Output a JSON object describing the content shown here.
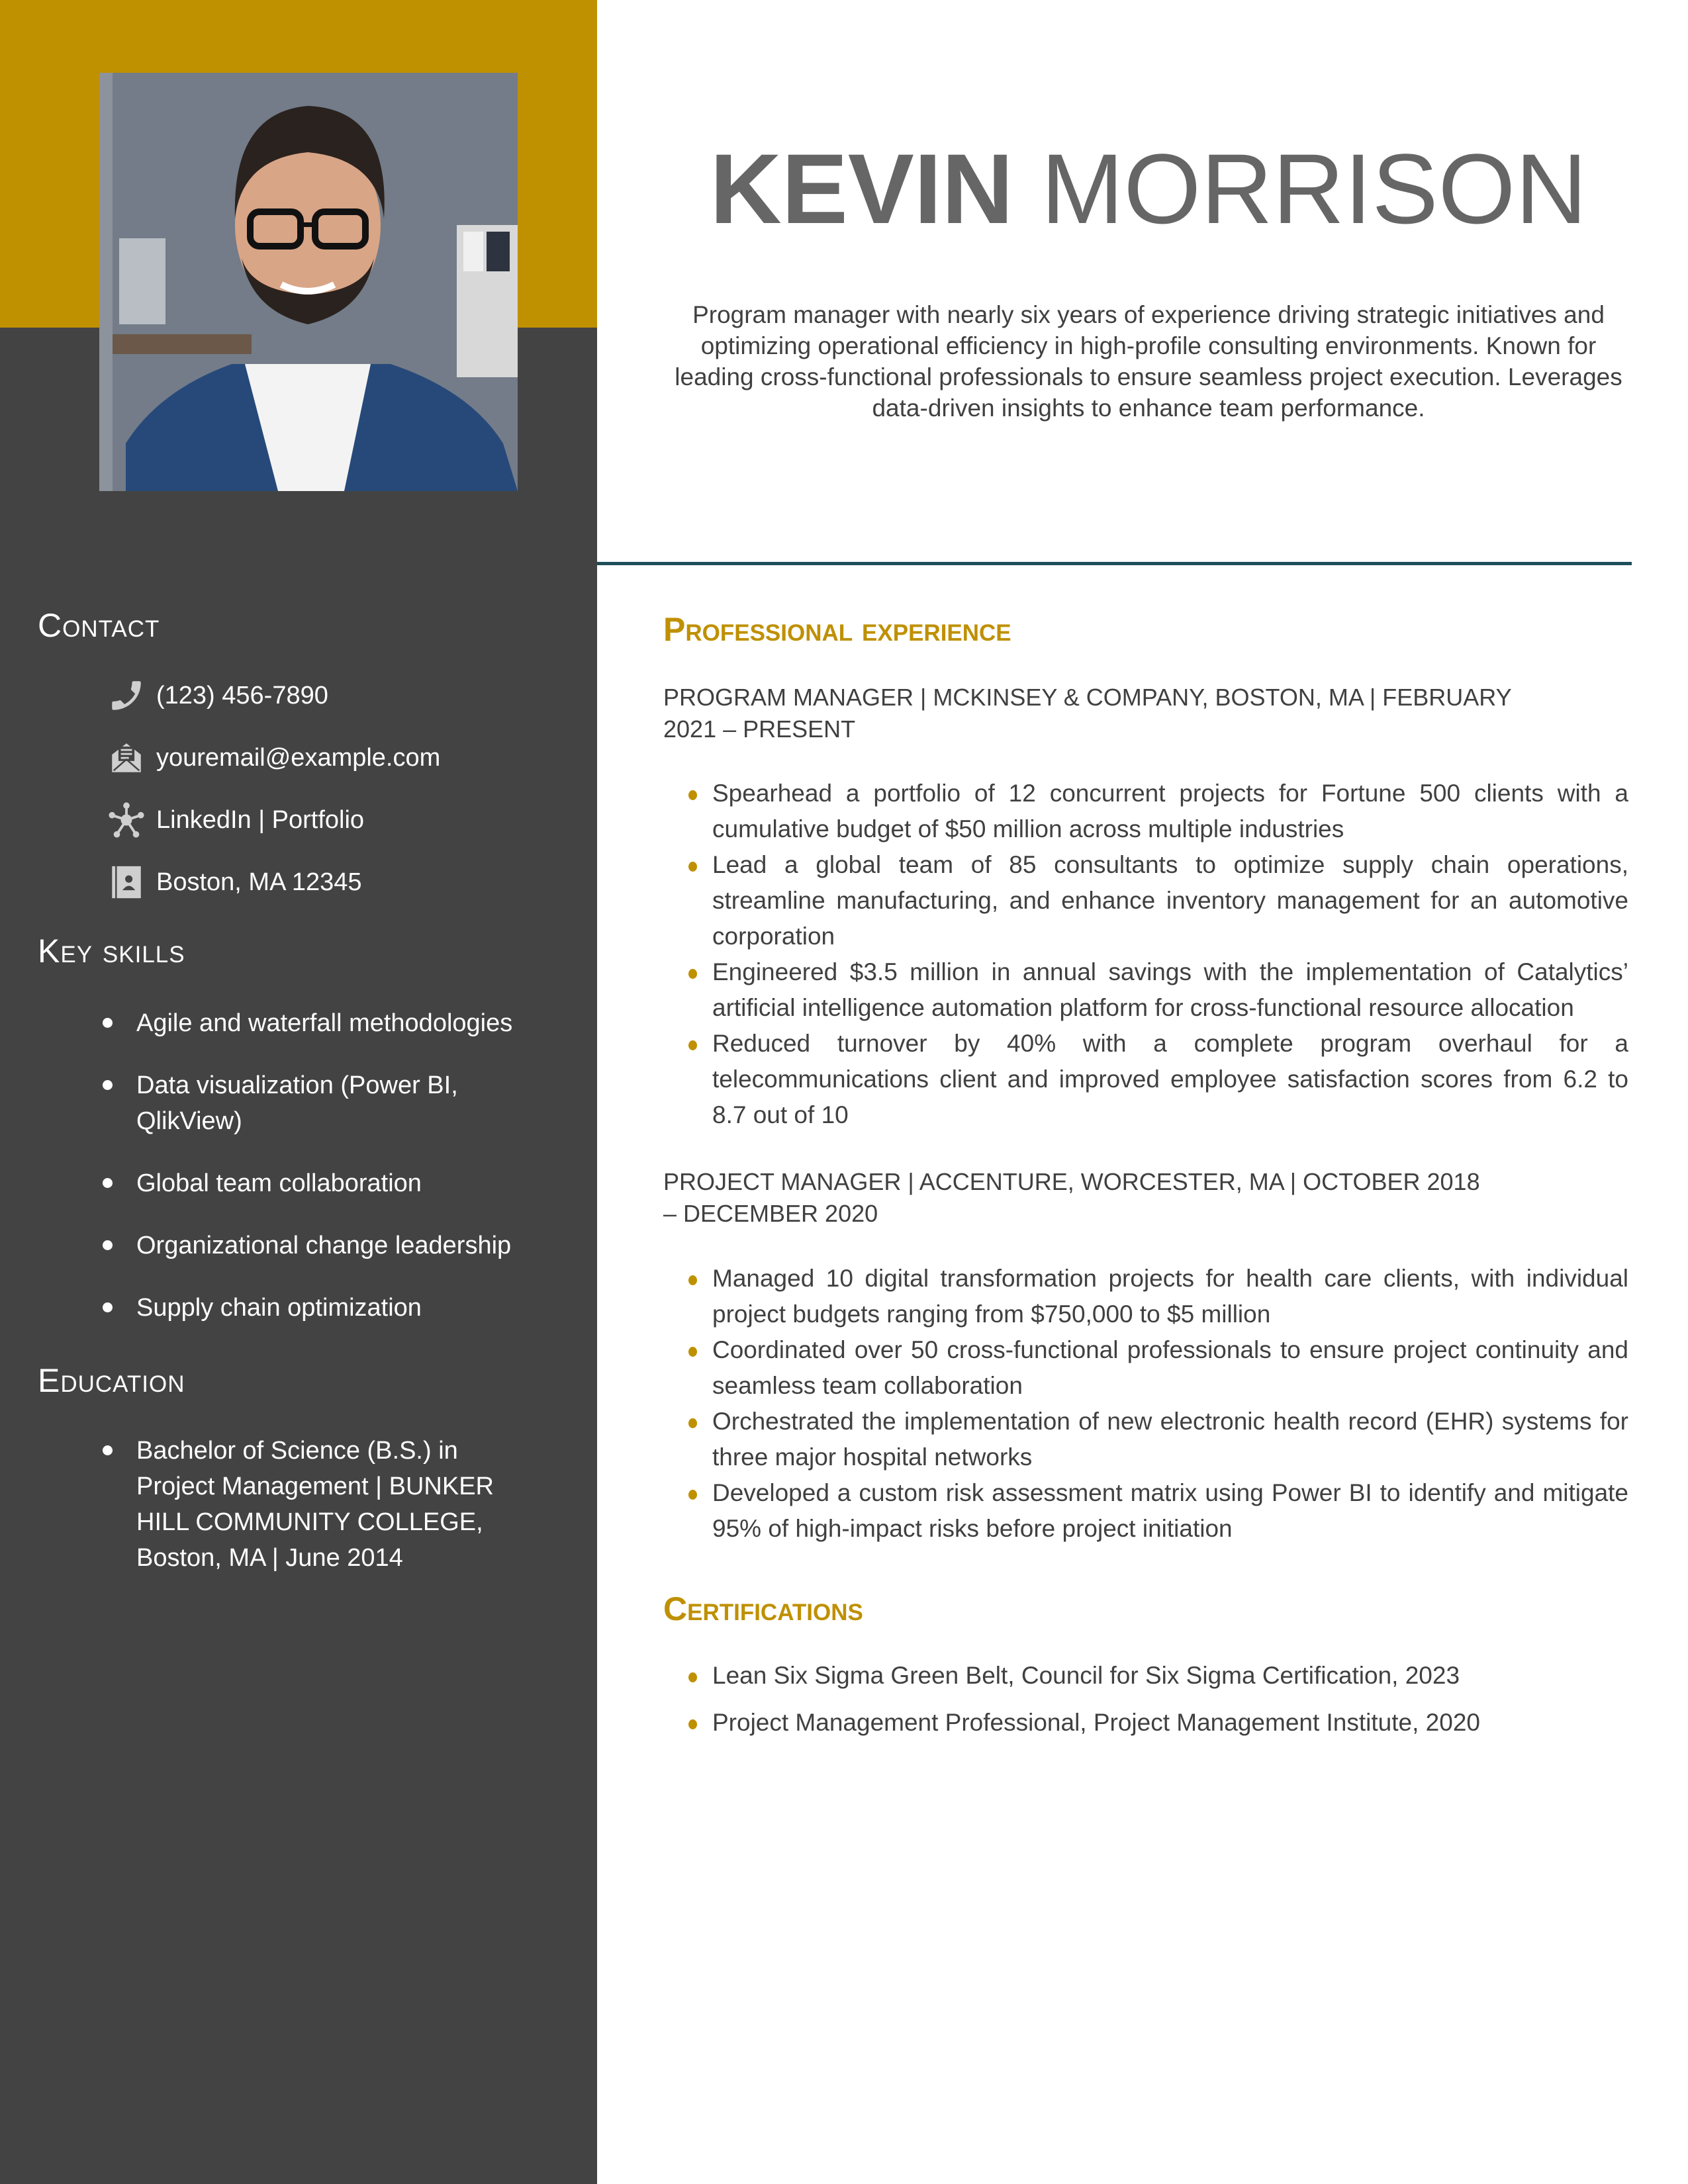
{
  "colors": {
    "accent": "#bf9000",
    "sidebar": "#434343",
    "divider": "#1d4e59",
    "text": "#404040",
    "name": "#666666"
  },
  "header": {
    "first_name": "KEVIN",
    "last_name": "MORRISON",
    "summary": "Program manager with nearly six years of experience driving strategic initiatives and optimizing operational efficiency in high-profile consulting environments. Known for leading cross-functional professionals to ensure seamless project execution. Leverages data-driven insights to enhance team performance."
  },
  "photo": {
    "alt": "profile-photo"
  },
  "sidebar": {
    "contact": {
      "heading": "Contact",
      "items": [
        {
          "icon": "phone-icon",
          "text": "(123) 456-7890"
        },
        {
          "icon": "email-icon",
          "text": "youremail@example.com"
        },
        {
          "icon": "network-icon",
          "text": "LinkedIn | Portfolio"
        },
        {
          "icon": "contact-card-icon",
          "text": "Boston, MA 12345"
        }
      ]
    },
    "skills": {
      "heading": "Key skills",
      "items": [
        "Agile and waterfall methodologies",
        "Data visualization (Power BI, QlikView)",
        "Global team collaboration",
        "Organizational change leadership",
        "Supply chain optimization"
      ]
    },
    "education": {
      "heading": "Education",
      "items": [
        "Bachelor of Science (B.S.) in Project Management | BUNKER HILL COMMUNITY COLLEGE, Boston, MA | June 2014"
      ]
    }
  },
  "experience": {
    "heading": "Professional experience",
    "jobs": [
      {
        "title": "PROGRAM MANAGER | MCKINSEY & COMPANY, BOSTON, MA | FEBRUARY 2021 – PRESENT",
        "bullets": [
          "Spearhead a portfolio of 12 concurrent projects for Fortune 500 clients with a cumulative budget of $50 million across multiple industries",
          "Lead a global team of 85 consultants to optimize supply chain operations, streamline manufacturing, and enhance inventory management for an automotive corporation",
          "Engineered $3.5 million in annual savings with the implementation of Catalytics’ artificial intelligence automation platform for cross-functional resource allocation",
          "Reduced turnover by 40% with a complete program overhaul for a telecommunications client and improved employee satisfaction scores from 6.2 to 8.7 out of 10"
        ]
      },
      {
        "title": "PROJECT MANAGER | ACCENTURE, WORCESTER, MA | OCTOBER 2018 – DECEMBER 2020",
        "bullets": [
          "Managed 10 digital transformation projects for health care clients, with individual project budgets ranging from $750,000 to $5 million",
          "Coordinated over 50 cross-functional professionals to ensure project continuity and seamless team collaboration",
          "Orchestrated the implementation of new electronic health record (EHR) systems for three major hospital networks",
          "Developed a custom risk assessment matrix using Power BI to identify and mitigate 95% of high-impact risks before project initiation"
        ]
      }
    ]
  },
  "certifications": {
    "heading": "Certifications",
    "items": [
      "Lean Six Sigma Green Belt, Council for Six Sigma Certification, 2023",
      "Project Management Professional, Project Management Institute, 2020"
    ]
  }
}
